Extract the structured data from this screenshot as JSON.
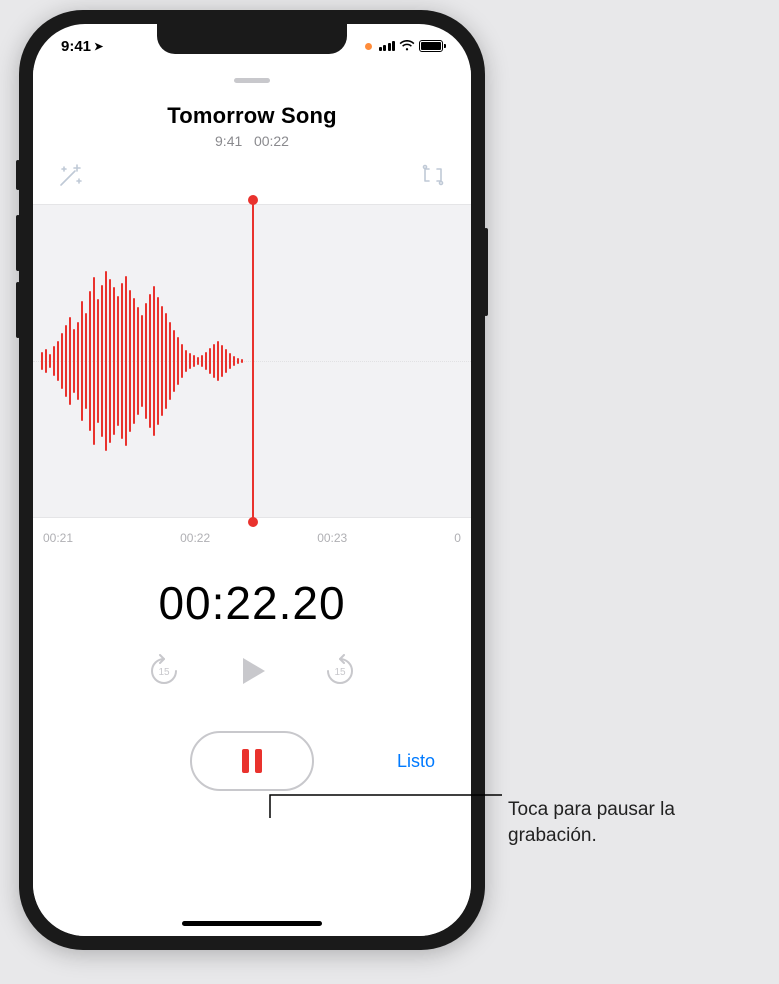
{
  "status": {
    "time": "9:41",
    "location_glyph": "➤"
  },
  "recording": {
    "title": "Tomorrow Song",
    "meta_time": "9:41",
    "meta_duration": "00:22"
  },
  "timeline": {
    "ticks": [
      "00:21",
      "00:22",
      "00:23",
      "0"
    ]
  },
  "timer": "00:22.20",
  "controls": {
    "done_label": "Listo"
  },
  "callout": {
    "text": "Toca para pausar la grabación."
  },
  "icons": {
    "enhance": "enhance-icon",
    "trim": "trim-icon",
    "skip_back": "skip-back-15-icon",
    "play": "play-icon",
    "skip_fwd": "skip-forward-15-icon",
    "pause": "pause-icon"
  }
}
